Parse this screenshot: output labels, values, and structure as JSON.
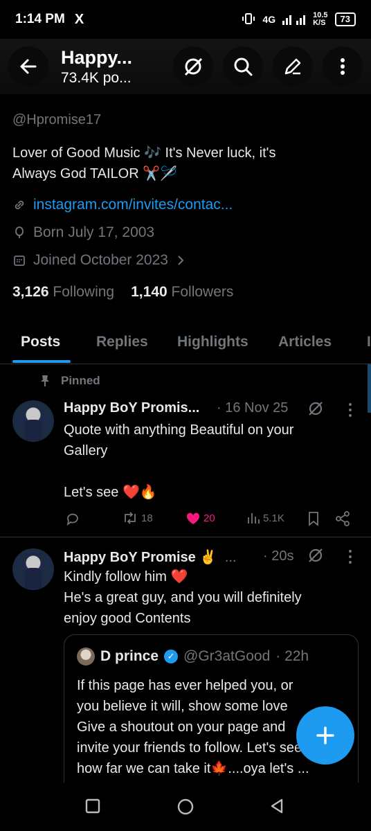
{
  "status": {
    "time": "1:14 PM",
    "app_icon": "X",
    "network": "4G",
    "speed": "10.5",
    "speed_unit": "K/S",
    "battery": "73"
  },
  "header": {
    "name": "Happy...",
    "post_count": "73.4K po..."
  },
  "profile": {
    "handle": "@Hpromise17",
    "bio_line1": "Lover of Good Music 🎶  It's Never luck, it's",
    "bio_line2": "Always God  TAILOR ✂️🪡",
    "link": "instagram.com/invites/contac...",
    "born": "Born July 17, 2003",
    "joined": "Joined October 2023",
    "following_count": "3,126",
    "following_label": "Following",
    "followers_count": "1,140",
    "followers_label": "Followers"
  },
  "tabs": [
    "Posts",
    "Replies",
    "Highlights",
    "Articles"
  ],
  "pinned_label": "Pinned",
  "post1": {
    "name": "Happy BoY Promis...",
    "date": "· 16 Nov 25",
    "line1": "Quote with anything Beautiful on your",
    "line2": "Gallery",
    "line3": "Let's see ❤️🔥",
    "retweets": "18",
    "likes": "20",
    "views": "5.1K"
  },
  "post2": {
    "name": "Happy BoY Promise ✌️",
    "ellipsis": "...",
    "date": "· 20s",
    "line1": "Kindly follow him ❤️",
    "line2": "He's a great guy, and you will definitely",
    "line3": "enjoy good Contents"
  },
  "quote": {
    "name": "D prince",
    "handle": "@Gr3atGood",
    "date": "· 22h",
    "line1": "If this page has ever helped you, or",
    "line2": "you believe it will, show some love",
    "line3": "Give a shoutout on your page and",
    "line4": "invite your friends to follow. Let's see",
    "line5": "how far we can take it🍁....oya let's ..."
  },
  "colors": {
    "accent": "#1d9bf0",
    "like": "#f91880",
    "muted": "#71767b"
  }
}
